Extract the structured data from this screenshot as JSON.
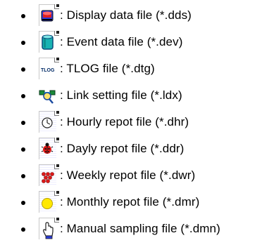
{
  "items": [
    {
      "icon": "display-data-icon",
      "label": ": Display data file (*.dds)"
    },
    {
      "icon": "event-data-icon",
      "label": ": Event data file (*.dev)"
    },
    {
      "icon": "tlog-icon",
      "label": ": TLOG file (*.dtg)",
      "icon_text": "TLOG"
    },
    {
      "icon": "link-setting-icon",
      "label": ": Link setting file (*.ldx)"
    },
    {
      "icon": "clock-icon",
      "label": ": Hourly repot file (*.dhr)"
    },
    {
      "icon": "ladybug-icon",
      "label": ": Dayly repot file (*.ddr)"
    },
    {
      "icon": "weekly-report-icon",
      "label": ": Weekly repot file (*.dwr)"
    },
    {
      "icon": "moon-icon",
      "label": ": Monthly repot file (*.dmr)"
    },
    {
      "icon": "manual-sampling-icon",
      "label": ": Manual sampling file (*.dmn)"
    }
  ]
}
